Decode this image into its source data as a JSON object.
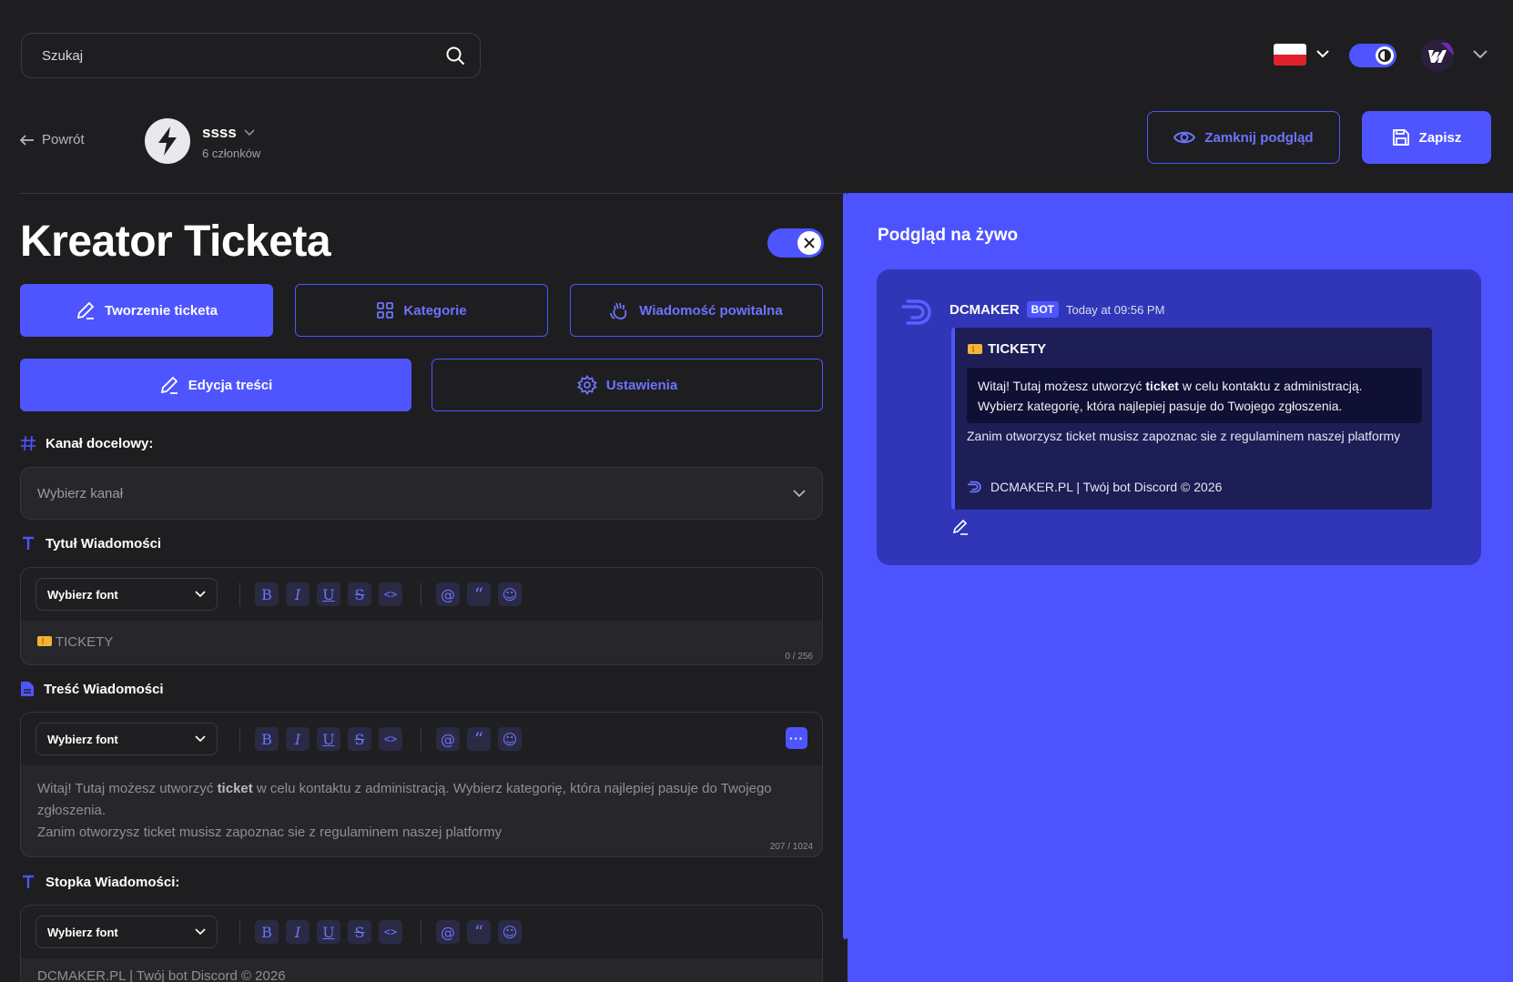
{
  "search": {
    "placeholder": "Szukaj"
  },
  "header": {
    "back_label": "Powrót",
    "server_name": "ssss",
    "server_members": "6 członków",
    "close_preview_label": "Zamknij podgląd",
    "save_label": "Zapisz"
  },
  "editor": {
    "title": "Kreator Ticketa",
    "tabs": [
      {
        "label": "Tworzenie ticketa",
        "active": true
      },
      {
        "label": "Kategorie",
        "active": false
      },
      {
        "label": "Wiadomość powitalna",
        "active": false
      }
    ],
    "subtabs": [
      {
        "label": "Edycja treści",
        "active": true
      },
      {
        "label": "Ustawienia",
        "active": false
      }
    ],
    "channel": {
      "label": "Kanał docelowy:",
      "placeholder": "Wybierz kanał"
    },
    "font_select_label": "Wybierz font",
    "title_section": {
      "label": "Tytuł Wiadomości",
      "value": "TICKETY",
      "counter": "0 / 256"
    },
    "content_section": {
      "label": "Treść Wiadomości",
      "line1_before": "Witaj! Tutaj możesz utworzyć ",
      "line1_bold": "ticket",
      "line1_after": " w celu kontaktu z administracją. Wybierz kategorię, która najlepiej pasuje do Twojego zgłoszenia.",
      "line2": "Zanim otworzysz ticket musisz zapoznac sie z regulaminem naszej platformy",
      "counter": "207 / 1024"
    },
    "footer_section": {
      "label": "Stopka Wiadomości:",
      "value": "DCMAKER.PL | Twój bot Discord © 2026"
    }
  },
  "preview": {
    "title": "Podgląd na żywo",
    "bot_name": "DCMAKER",
    "bot_badge": "BOT",
    "timestamp": "Today at 09:56 PM",
    "embed_title": "TICKETY",
    "embed_code_before": "Witaj! Tutaj możesz utworzyć ",
    "embed_code_bold": "ticket",
    "embed_code_after": " w celu kontaktu z administracją. Wybierz kategorię, która najlepiej pasuje do Twojego zgłoszenia.",
    "embed_text": "Zanim otworzysz ticket musisz zapoznac sie z regulaminem naszej platformy",
    "embed_footer": "DCMAKER.PL | Twój bot Discord © 2026"
  },
  "colors": {
    "accent": "#4e55ff",
    "background": "#1e1e20",
    "preview_card": "#3136b8",
    "embed_bg": "#1d1e55"
  },
  "icons": [
    "search-icon",
    "chevron-down-icon",
    "theme-toggle-icon",
    "arrow-left-icon",
    "lightning-icon",
    "eye-icon",
    "save-icon",
    "pencil-icon",
    "grid-icon",
    "wave-hand-icon",
    "settings-icon",
    "hash-icon",
    "text-t-icon",
    "document-icon",
    "close-icon",
    "ticket-icon",
    "dcmaker-logo-icon"
  ]
}
